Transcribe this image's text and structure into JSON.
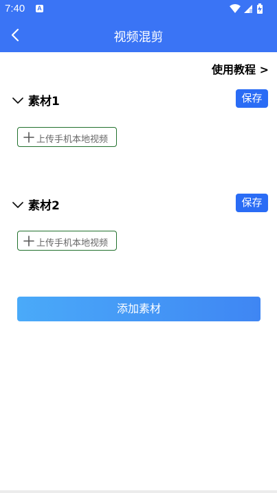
{
  "status_bar": {
    "time": "7:40",
    "notification_badge": "A",
    "icons": [
      "wifi-icon",
      "signal-icon",
      "battery-icon"
    ]
  },
  "header": {
    "title": "视频混剪",
    "back_icon": "chevron-left-icon"
  },
  "tutorial_link": "使用教程 >",
  "sections": [
    {
      "title": "素材1",
      "save_label": "保存",
      "upload_label": "上传手机本地视频"
    },
    {
      "title": "素材2",
      "save_label": "保存",
      "upload_label": "上传手机本地视频"
    }
  ],
  "add_material_label": "添加素材",
  "colors": {
    "header_background": "#3a74f5",
    "save_button": "#2a6cf5",
    "upload_border": "#1f6f2a",
    "add_button_start": "#4aaaf9",
    "add_button_end": "#3f86f3"
  }
}
